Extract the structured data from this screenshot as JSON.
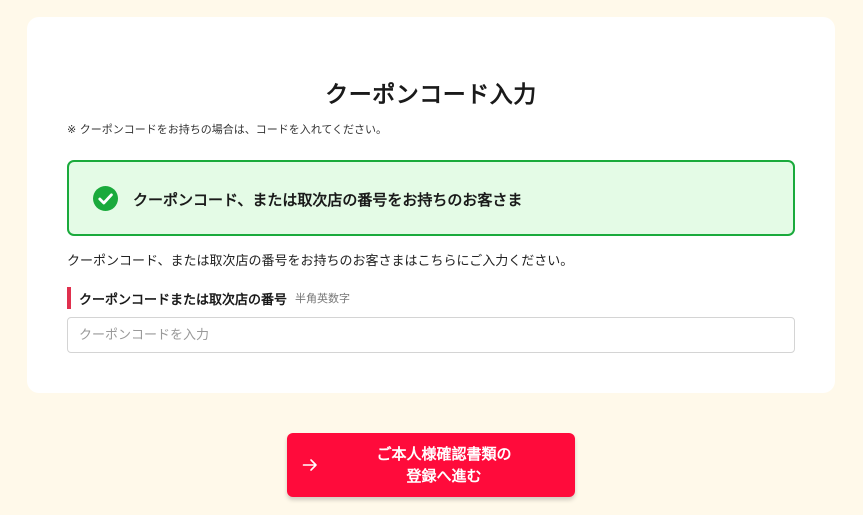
{
  "page": {
    "title": "クーポンコード入力",
    "note": "※ クーポンコードをお持ちの場合は、コードを入れてください。"
  },
  "option": {
    "label": "クーポンコード、または取次店の番号をお持ちのお客さま",
    "selected": true,
    "icon": "check-circle-icon"
  },
  "description": "クーポンコード、または取次店の番号をお持ちのお客さまはこちらにご入力ください。",
  "field": {
    "label": "クーポンコードまたは取次店の番号",
    "hint": "半角英数字",
    "placeholder": "クーポンコードを入力",
    "value": ""
  },
  "submit": {
    "line1": "ご本人様確認書類の",
    "line2": "登録へ進む",
    "icon": "arrow-right-icon"
  },
  "colors": {
    "background": "#fff9ea",
    "accent": "#ff0b3b",
    "success": "#1aaa3c",
    "success_bg": "#e4fbe6",
    "label_bar": "#e0304e"
  }
}
